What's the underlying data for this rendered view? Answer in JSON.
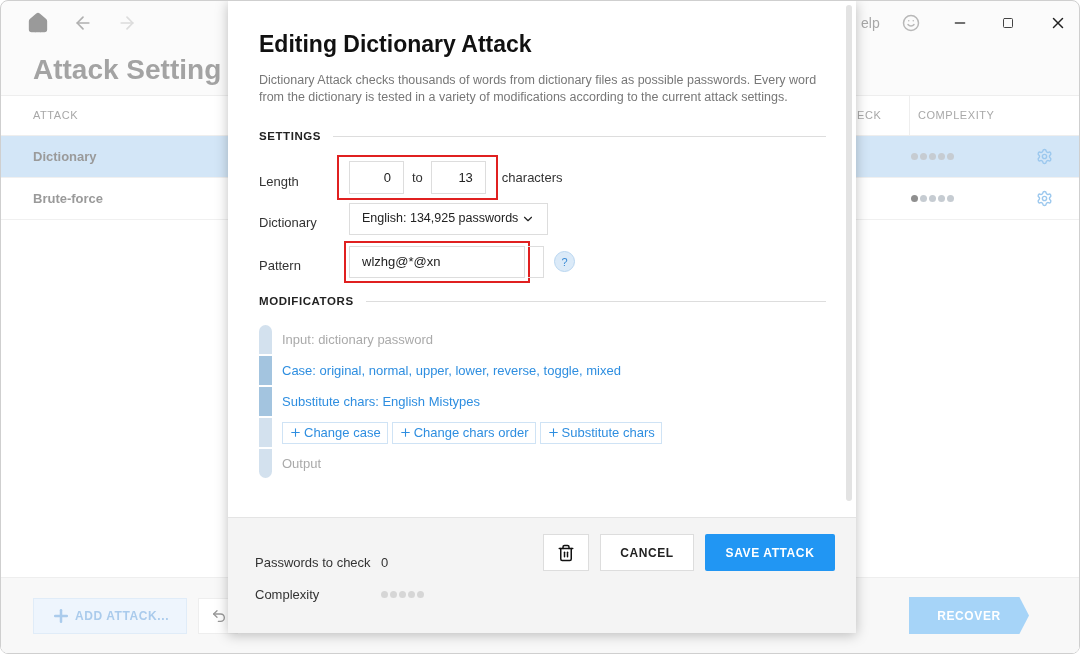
{
  "app": {
    "heading": "Attack Setting",
    "help_label": "elp",
    "columns": [
      "ATTACK",
      "ECK",
      "COMPLEXITY"
    ],
    "rows": [
      {
        "name": "Dictionary",
        "selected": true,
        "stars": 0
      },
      {
        "name": "Brute-force",
        "selected": false,
        "stars": 1
      }
    ],
    "add_button": "ADD ATTACK...",
    "recover_button": "RECOVER"
  },
  "dialog": {
    "title": "Editing Dictionary Attack",
    "description": "Dictionary Attack checks thousands of words from dictionary files as possible passwords. Every word from the dictionary is tested in a variety of modifications according to the current attack settings.",
    "settings_heading": "SETTINGS",
    "length": {
      "label": "Length",
      "from": "0",
      "separator": "to",
      "to": "13",
      "unit": "characters",
      "highlighted": true
    },
    "dictionary": {
      "label": "Dictionary",
      "value": "English: 134,925 passwords"
    },
    "pattern": {
      "label": "Pattern",
      "value": "wlzhg@*@xn",
      "help": "?",
      "highlighted": true
    },
    "modificators_heading": "MODIFICATORS",
    "steps": [
      {
        "kind": "endpoint",
        "text": "Input: dictionary password"
      },
      {
        "kind": "modifier",
        "text": "Case: original, normal, upper, lower, reverse, toggle, mixed"
      },
      {
        "kind": "modifier",
        "text": "Substitute chars: English Mistypes"
      },
      {
        "kind": "add",
        "buttons": [
          "Change case",
          "Change chars order",
          "Substitute chars"
        ]
      },
      {
        "kind": "endpoint",
        "text": "Output"
      }
    ],
    "footer": {
      "passwords_label": "Passwords to check",
      "passwords_value": "0",
      "complexity": {
        "label": "Complexity",
        "stars": 0
      },
      "cancel": "CANCEL",
      "save": "SAVE ATTACK"
    }
  }
}
